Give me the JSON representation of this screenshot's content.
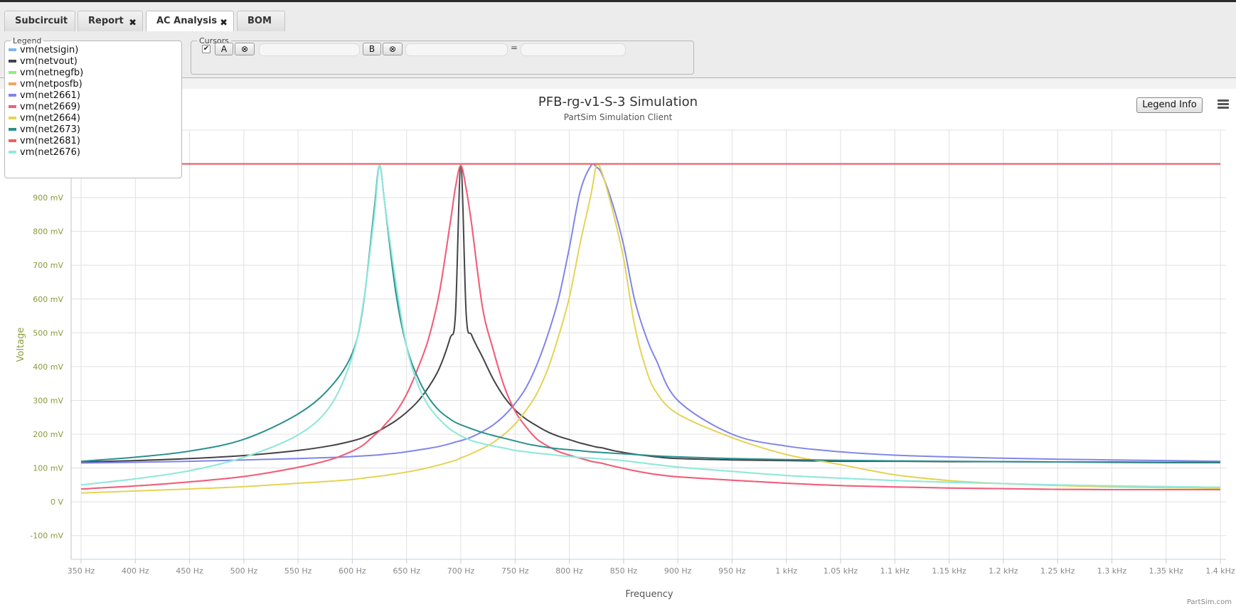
{
  "tabs": [
    {
      "label": "Subcircuit",
      "closable": false,
      "active": false
    },
    {
      "label": "Report",
      "closable": true,
      "active": false
    },
    {
      "label": "AC Analysis",
      "closable": true,
      "active": true
    },
    {
      "label": "BOM",
      "closable": false,
      "active": false
    }
  ],
  "legend_panel": {
    "label": "Legend"
  },
  "cursors_panel": {
    "label": "Cursors",
    "checkbox_mark": "✔",
    "cursor_a_label": "A",
    "cursor_b_label": "B",
    "remove_glyph": "⊗",
    "equals": "=",
    "cursor_a_value": "",
    "cursor_b_value": "",
    "difference_value": ""
  },
  "legend_info_button": "Legend Info",
  "credit": "PartSim.com",
  "chart_data": {
    "type": "line",
    "title": "PFB-rg-v1-S-3 Simulation",
    "subtitle": "PartSim Simulation Client",
    "xlabel": "Frequency",
    "ylabel": "Voltage",
    "xlim": [
      350,
      1400
    ],
    "ylim": [
      -170,
      1100
    ],
    "x_unit": "Hz",
    "y_unit": "mV",
    "grid": true,
    "x_ticks": [
      {
        "value": 350,
        "label": "350 Hz"
      },
      {
        "value": 400,
        "label": "400 Hz"
      },
      {
        "value": 450,
        "label": "450 Hz"
      },
      {
        "value": 500,
        "label": "500 Hz"
      },
      {
        "value": 550,
        "label": "550 Hz"
      },
      {
        "value": 600,
        "label": "600 Hz"
      },
      {
        "value": 650,
        "label": "650 Hz"
      },
      {
        "value": 700,
        "label": "700 Hz"
      },
      {
        "value": 750,
        "label": "750 Hz"
      },
      {
        "value": 800,
        "label": "800 Hz"
      },
      {
        "value": 850,
        "label": "850 Hz"
      },
      {
        "value": 900,
        "label": "900 Hz"
      },
      {
        "value": 950,
        "label": "950 Hz"
      },
      {
        "value": 1000,
        "label": "1 kHz"
      },
      {
        "value": 1050,
        "label": "1.05 kHz"
      },
      {
        "value": 1100,
        "label": "1.1 kHz"
      },
      {
        "value": 1150,
        "label": "1.15 kHz"
      },
      {
        "value": 1200,
        "label": "1.2 kHz"
      },
      {
        "value": 1250,
        "label": "1.25 kHz"
      },
      {
        "value": 1300,
        "label": "1.3 kHz"
      },
      {
        "value": 1350,
        "label": "1.35 kHz"
      },
      {
        "value": 1400,
        "label": "1.4 kHz"
      }
    ],
    "y_ticks": [
      {
        "value": -100,
        "label": "-100 mV"
      },
      {
        "value": 0,
        "label": "0 V"
      },
      {
        "value": 100,
        "label": "100 mV"
      },
      {
        "value": 200,
        "label": "200 mV"
      },
      {
        "value": 300,
        "label": "300 mV"
      },
      {
        "value": 400,
        "label": "400 mV"
      },
      {
        "value": 500,
        "label": "500 mV"
      },
      {
        "value": 600,
        "label": "600 mV"
      },
      {
        "value": 700,
        "label": "700 mV"
      },
      {
        "value": 800,
        "label": "800 mV"
      },
      {
        "value": 900,
        "label": "900 mV"
      }
    ],
    "x": [
      350,
      400,
      450,
      500,
      550,
      580,
      600,
      610,
      620,
      625,
      630,
      640,
      650,
      660,
      670,
      680,
      690,
      695,
      700,
      705,
      710,
      720,
      730,
      740,
      750,
      760,
      770,
      780,
      790,
      800,
      810,
      820,
      825,
      830,
      840,
      850,
      860,
      870,
      880,
      900,
      950,
      1000,
      1050,
      1100,
      1150,
      1200,
      1250,
      1300,
      1350,
      1400
    ],
    "series": [
      {
        "name": "vm(netsigin)",
        "color": "#7cb5ec",
        "values": [
          1000,
          1000,
          1000,
          1000,
          1000,
          1000,
          1000,
          1000,
          1000,
          1000,
          1000,
          1000,
          1000,
          1000,
          1000,
          1000,
          1000,
          1000,
          1000,
          1000,
          1000,
          1000,
          1000,
          1000,
          1000,
          1000,
          1000,
          1000,
          1000,
          1000,
          1000,
          1000,
          1000,
          1000,
          1000,
          1000,
          1000,
          1000,
          1000,
          1000,
          1000,
          1000,
          1000,
          1000,
          1000,
          1000,
          1000,
          1000,
          1000,
          1000
        ]
      },
      {
        "name": "vm(netvout)",
        "color": "#434348",
        "values": [
          118,
          122,
          128,
          137,
          152,
          166,
          180,
          190,
          203,
          211,
          220,
          240,
          265,
          296,
          338,
          394,
          483,
          553,
          995,
          553,
          493,
          428,
          362,
          310,
          272,
          245,
          225,
          207,
          194,
          184,
          174,
          166,
          162,
          160,
          152,
          146,
          141,
          137,
          133,
          128,
          124,
          122,
          120,
          120,
          119,
          119,
          118,
          117,
          116,
          116
        ]
      },
      {
        "name": "vm(netnegfb)",
        "color": "#90ed7d",
        "values": [
          50,
          68,
          92,
          132,
          198,
          285,
          430,
          585,
          840,
          995,
          880,
          650,
          460,
          350,
          285,
          245,
          215,
          205,
          195,
          188,
          181,
          172,
          165,
          159,
          152,
          148,
          144,
          141,
          137,
          134,
          131,
          129,
          128,
          127,
          125,
          122,
          118,
          114,
          110,
          103,
          90,
          78,
          70,
          63,
          58,
          54,
          50,
          47,
          45,
          43
        ]
      },
      {
        "name": "vm(netposfb)",
        "color": "#f7a35c",
        "values": [
          38,
          47,
          59,
          75,
          102,
          125,
          150,
          168,
          196,
          210,
          228,
          265,
          318,
          392,
          480,
          615,
          820,
          930,
          995,
          925,
          820,
          575,
          448,
          342,
          268,
          222,
          186,
          165,
          149,
          138,
          129,
          120,
          117,
          114,
          106,
          99,
          92,
          86,
          81,
          74,
          64,
          55,
          48,
          44,
          41,
          39,
          37,
          36,
          36,
          36
        ]
      },
      {
        "name": "vm(net2661)",
        "color": "#8085e9",
        "values": [
          115,
          117,
          120,
          124,
          128,
          131,
          134,
          136,
          138,
          139,
          141,
          144,
          148,
          153,
          158,
          164,
          172,
          177,
          181,
          186,
          192,
          208,
          228,
          255,
          291,
          337,
          405,
          493,
          600,
          752,
          918,
          995,
          990,
          970,
          880,
          760,
          600,
          495,
          420,
          300,
          200,
          165,
          148,
          138,
          133,
          129,
          126,
          124,
          122,
          120
        ]
      },
      {
        "name": "vm(net2669)",
        "color": "#f15c80",
        "values": [
          38,
          47,
          59,
          75,
          102,
          125,
          150,
          168,
          196,
          210,
          228,
          265,
          318,
          392,
          480,
          615,
          820,
          930,
          995,
          925,
          820,
          575,
          448,
          342,
          268,
          222,
          186,
          165,
          149,
          138,
          129,
          120,
          117,
          114,
          106,
          99,
          92,
          86,
          81,
          74,
          64,
          55,
          48,
          44,
          41,
          39,
          37,
          36,
          36,
          36
        ]
      },
      {
        "name": "vm(net2664)",
        "color": "#e4d354",
        "values": [
          26,
          32,
          38,
          45,
          55,
          61,
          66,
          70,
          74,
          76,
          78,
          83,
          88,
          94,
          101,
          109,
          118,
          123,
          130,
          136,
          143,
          158,
          176,
          200,
          230,
          270,
          320,
          392,
          489,
          605,
          765,
          910,
          995,
          975,
          860,
          720,
          525,
          400,
          325,
          260,
          190,
          140,
          110,
          80,
          63,
          54,
          48,
          44,
          42,
          40
        ]
      },
      {
        "name": "vm(net2673)",
        "color": "#2b908f",
        "values": [
          120,
          132,
          150,
          185,
          260,
          340,
          440,
          580,
          860,
          995,
          880,
          620,
          460,
          370,
          310,
          270,
          245,
          235,
          228,
          222,
          216,
          205,
          196,
          188,
          180,
          172,
          166,
          161,
          157,
          154,
          151,
          148,
          147,
          146,
          144,
          142,
          140,
          138,
          136,
          133,
          128,
          125,
          123,
          121,
          120,
          119,
          118,
          118,
          117,
          117
        ]
      },
      {
        "name": "vm(net2681)",
        "color": "#f45b5b",
        "values": [
          1000,
          1000,
          1000,
          1000,
          1000,
          1000,
          1000,
          1000,
          1000,
          1000,
          1000,
          1000,
          1000,
          1000,
          1000,
          1000,
          1000,
          1000,
          1000,
          1000,
          1000,
          1000,
          1000,
          1000,
          1000,
          1000,
          1000,
          1000,
          1000,
          1000,
          1000,
          1000,
          1000,
          1000,
          1000,
          1000,
          1000,
          1000,
          1000,
          1000,
          1000,
          1000,
          1000,
          1000,
          1000,
          1000,
          1000,
          1000,
          1000,
          1000
        ]
      },
      {
        "name": "vm(net2676)",
        "color": "#91e8e1",
        "values": [
          50,
          68,
          92,
          132,
          198,
          285,
          430,
          585,
          840,
          995,
          880,
          650,
          460,
          350,
          285,
          245,
          215,
          205,
          195,
          188,
          181,
          172,
          165,
          159,
          152,
          148,
          144,
          141,
          137,
          134,
          131,
          129,
          128,
          127,
          125,
          122,
          118,
          114,
          110,
          103,
          90,
          78,
          70,
          63,
          58,
          54,
          50,
          47,
          45,
          43
        ]
      }
    ]
  }
}
